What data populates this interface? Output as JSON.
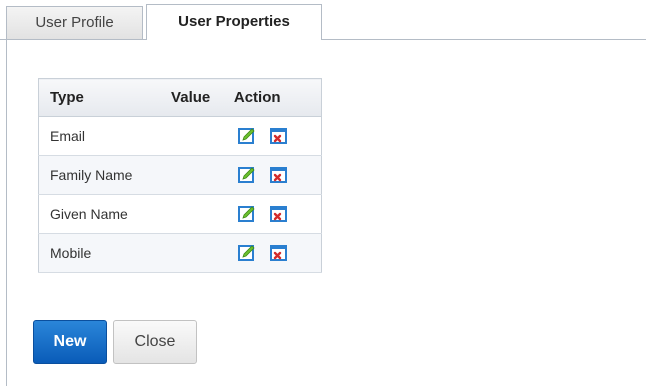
{
  "tabs": {
    "user_profile": "User Profile",
    "user_properties": "User Properties"
  },
  "grid": {
    "headers": {
      "type": "Type",
      "value": "Value",
      "action": "Action"
    },
    "rows": [
      {
        "type": "Email",
        "value": ""
      },
      {
        "type": "Family Name",
        "value": ""
      },
      {
        "type": "Given Name",
        "value": ""
      },
      {
        "type": "Mobile",
        "value": ""
      }
    ],
    "action_icons": [
      "edit-icon",
      "delete-icon"
    ]
  },
  "buttons": {
    "new": "New",
    "close": "Close"
  },
  "colors": {
    "primary_button": "#1170cc",
    "border": "#b4bcc6",
    "edit_icon_green": "#6cc12e",
    "delete_icon_red": "#d22b2b",
    "icon_blue": "#2a7fd0"
  }
}
